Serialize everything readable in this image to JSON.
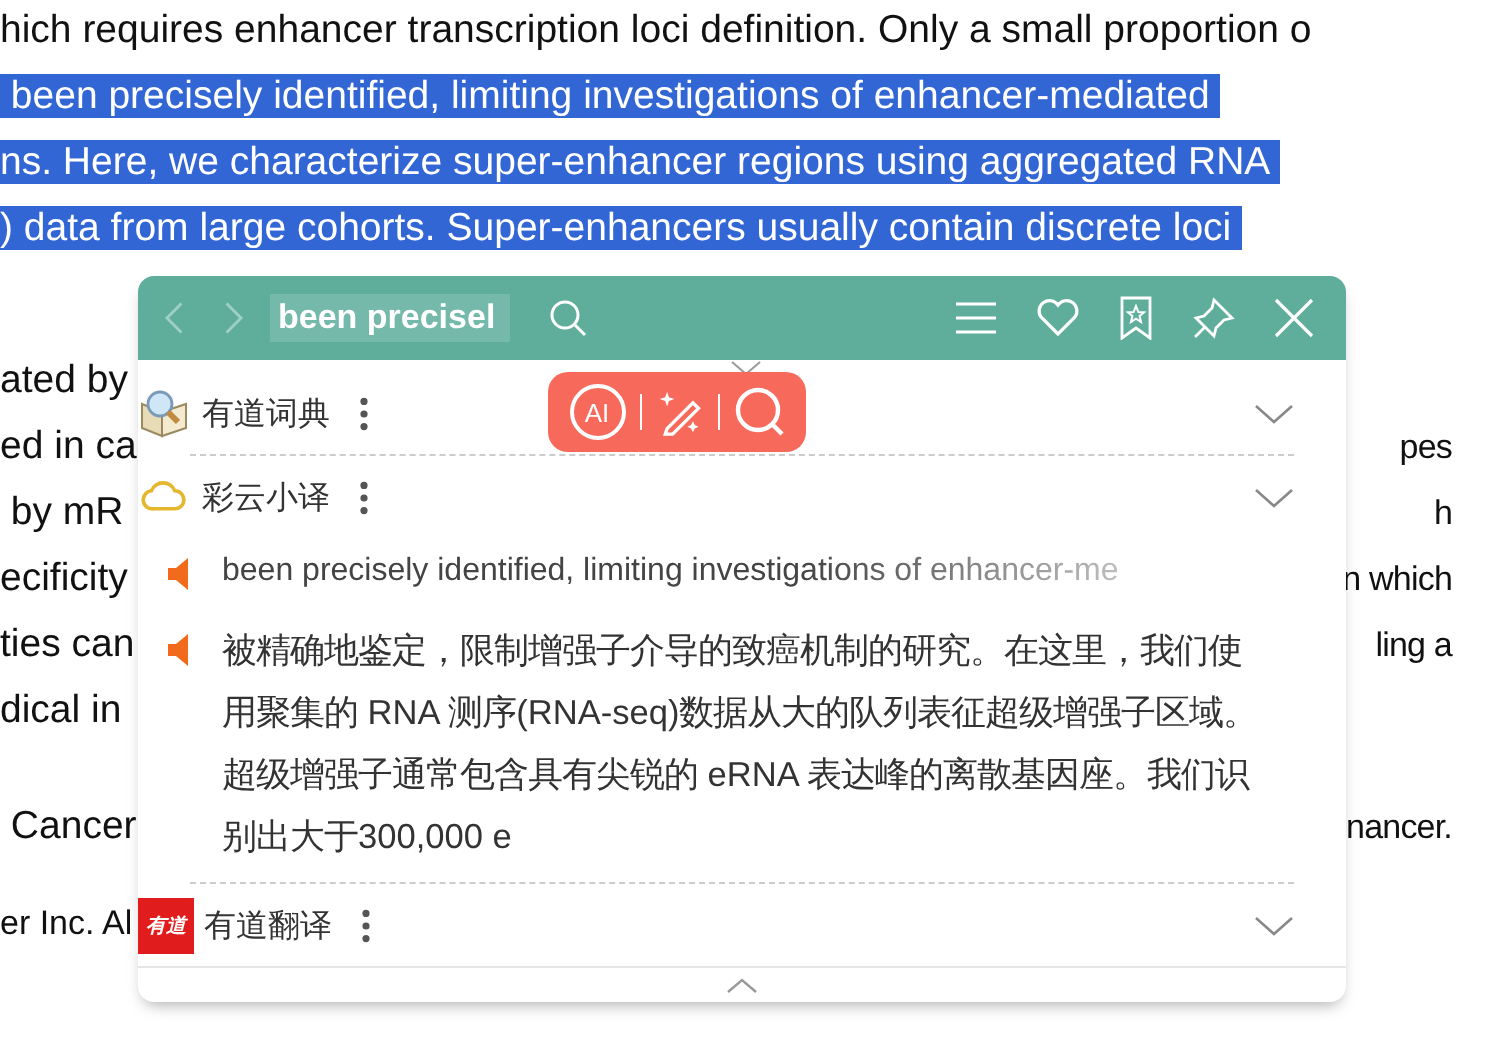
{
  "article": [
    {
      "kind": "lead",
      "lines": [
        {
          "left": [
            {
              "text": "hich requires enhancer transcription loci definition. Only a small proportion o",
              "selected": false
            }
          ]
        },
        {
          "left": [
            {
              "text": " been precisely identified, limiting investigations of enhancer-mediated ",
              "selected": true
            }
          ]
        },
        {
          "left": [
            {
              "text": "ns. Here, we characterize super-enhancer regions using aggregated RNA ",
              "selected": true
            }
          ]
        },
        {
          "left": [
            {
              "text": ") data from large cohorts. Super-enhancers usually contain discrete loci ",
              "selected": true
            }
          ]
        }
      ]
    },
    {
      "kind": "body",
      "lines": [
        {
          "left": [
            {
              "text": "ated by",
              "selected": false
            }
          ]
        },
        {
          "left": [
            {
              "text": "ed in ca",
              "selected": false
            }
          ],
          "right": "pes"
        },
        {
          "left": [
            {
              "text": " by mR",
              "selected": false
            }
          ],
          "right": "h"
        },
        {
          "left": [
            {
              "text": "ecificity",
              "selected": false
            }
          ],
          "right": "n which"
        },
        {
          "left": [
            {
              "text": "ties can",
              "selected": false
            }
          ],
          "right": "ling a"
        },
        {
          "left": [
            {
              "text": "dical in",
              "selected": false
            }
          ]
        }
      ]
    },
    {
      "kind": "body",
      "lines": [
        {
          "left": [
            {
              "text": " Cancer",
              "selected": false
            }
          ],
          "right": "nancer."
        }
      ]
    },
    {
      "kind": "footer",
      "lines": [
        {
          "left": [
            {
              "text": "er Inc. Al",
              "selected": false
            }
          ]
        }
      ]
    }
  ],
  "popup": {
    "search": {
      "value": "been precisel"
    },
    "toolbar": {
      "ai_label": "AI"
    },
    "sections": [
      {
        "kind": "dict",
        "title": "有道词典"
      },
      {
        "kind": "caiyun",
        "title": "彩云小译",
        "results": [
          {
            "kind": "source",
            "text": "been precisely identified, limiting investigations of enhancer-me"
          },
          {
            "kind": "translation",
            "text": "被精确地鉴定，限制增强子介导的致癌机制的研究。在这里，我们使用聚集的 RNA 测序(RNA-seq)数据从大的队列表征超级增强子区域。超级增强子通常包含具有尖锐的 eRNA 表达峰的离散基因座。我们识别出大于300,000 e"
          }
        ]
      },
      {
        "kind": "youdao",
        "title": "有道翻译",
        "logo_text": "有道"
      }
    ]
  }
}
